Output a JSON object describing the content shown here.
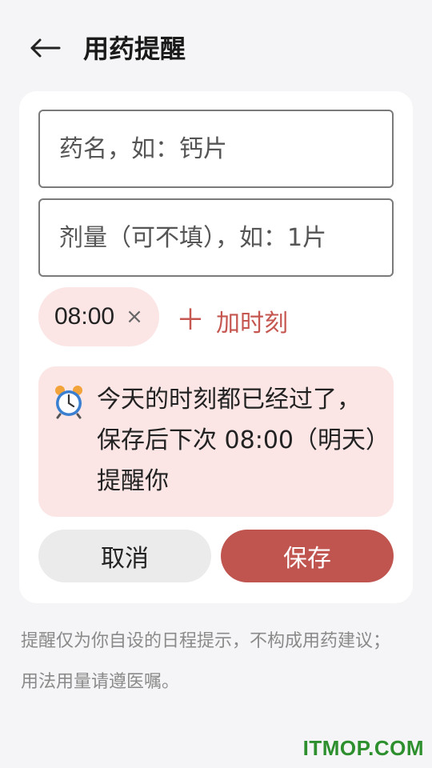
{
  "header": {
    "title": "用药提醒",
    "back_icon": "arrow-left-icon"
  },
  "form": {
    "name_placeholder": "药名，如：钙片",
    "name_value": "",
    "dose_placeholder": "剂量（可不填），如：1片",
    "dose_value": ""
  },
  "times": {
    "chips": [
      {
        "time": "08:00",
        "remove_label": "×"
      }
    ],
    "add_icon": "＋",
    "add_label": "加时刻"
  },
  "notice": {
    "icon": "alarm-clock-icon",
    "text": "今天的时刻都已经过了，保存后下次 08:00（明天）提醒你"
  },
  "actions": {
    "cancel_label": "取消",
    "save_label": "保存"
  },
  "footer": {
    "note": "提醒仅为你自设的日程提示，不构成用药建议；用法用量请遵医嘱。"
  },
  "watermark": "ITMOP.COM",
  "colors": {
    "accent": "#c05550",
    "chip_bg": "#fbe5e5",
    "page_bg": "#f5f5f7"
  }
}
